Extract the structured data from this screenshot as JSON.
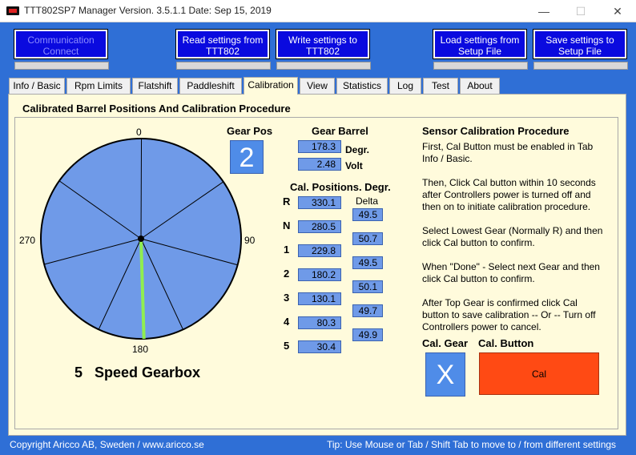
{
  "window": {
    "title": "TTT802SP7 Manager Version. 3.5.1.1  Date: Sep 15, 2019",
    "minimize": "—",
    "maximize": "☐",
    "close": "✕"
  },
  "toolbar": {
    "communication": {
      "line1": "Communication",
      "line2": "Connect"
    },
    "read": {
      "line1": "Read settings from",
      "line2": "TTT802"
    },
    "write": {
      "line1": "Write settings to",
      "line2": "TTT802"
    },
    "load": {
      "line1": "Load settings from",
      "line2": "Setup File"
    },
    "save": {
      "line1": "Save settings to",
      "line2": "Setup File"
    }
  },
  "tabs": [
    "Info / Basic",
    "Rpm Limits",
    "Flatshift",
    "Paddleshift",
    "Calibration",
    "View",
    "Statistics",
    "Log",
    "Test",
    "About"
  ],
  "active_tab": "Calibration",
  "panel": {
    "heading": "Calibrated Barrel Positions And Calibration Procedure",
    "dial": {
      "label_top": "0",
      "label_right": "90",
      "label_bottom": "180",
      "label_left": "270",
      "needle_angle_deg": 178.3,
      "positions_deg": [
        330.1,
        280.5,
        229.8,
        180.2,
        130.1,
        80.3,
        30.4
      ]
    },
    "gearbox_label": "5   Speed Gearbox",
    "gear_pos": {
      "label": "Gear Pos",
      "value": "2"
    },
    "gear_barrel": {
      "label": "Gear Barrel",
      "degrees": "178.3",
      "degrees_unit": "Degr.",
      "volt": "2.48",
      "volt_unit": "Volt"
    },
    "cal_positions": {
      "label": "Cal. Positions. Degr.",
      "delta_label": "Delta",
      "gears": [
        {
          "name": "R",
          "value": "330.1"
        },
        {
          "name": "N",
          "value": "280.5"
        },
        {
          "name": "1",
          "value": "229.8"
        },
        {
          "name": "2",
          "value": "180.2"
        },
        {
          "name": "3",
          "value": "130.1"
        },
        {
          "name": "4",
          "value": "80.3"
        },
        {
          "name": "5",
          "value": "30.4"
        }
      ],
      "deltas": [
        "49.5",
        "50.7",
        "49.5",
        "50.1",
        "49.7",
        "49.9"
      ]
    },
    "procedure": {
      "title": "Sensor Calibration Procedure",
      "p1": "First, Cal Button must be enabled in Tab Info / Basic.",
      "p2": "Then, Click Cal button within 10 seconds after Controllers power is turned off and then on to initiate calibration procedure.",
      "p3": "Select Lowest Gear (Normally R) and then click Cal button to confirm.",
      "p4": "When \"Done\" - Select next Gear and then click Cal button to confirm.",
      "p5": "After Top Gear is confirmed click Cal button to save calibration  -- Or -- Turn off Controllers power to cancel."
    },
    "cal_gear": {
      "label": "Cal. Gear",
      "value": "X"
    },
    "cal_button": {
      "label": "Cal. Button",
      "text": "Cal"
    }
  },
  "status": {
    "left": "Copyright Aricco AB, Sweden / www.aricco.se",
    "right": "Tip:  Use Mouse or Tab / Shift Tab to move to / from  different settings"
  },
  "colors": {
    "background": "#2f6fd6",
    "button": "#0a0adf",
    "panel": "#fffbdc",
    "dial": "#6f9ae8",
    "needle": "#90ee50",
    "cal_button": "#ff4a14"
  }
}
